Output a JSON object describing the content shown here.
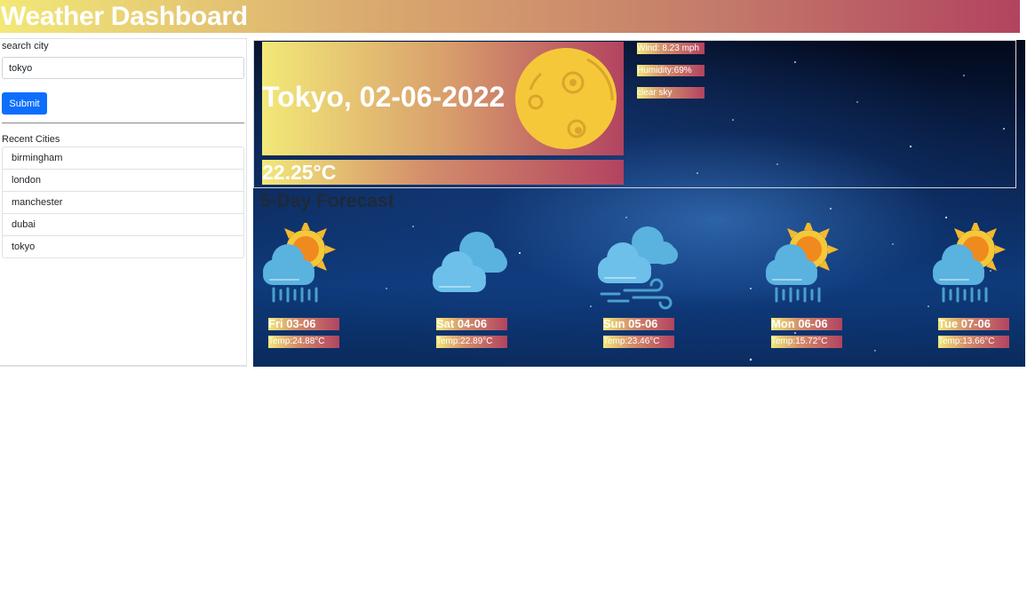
{
  "header": {
    "title": "Weather Dashboard"
  },
  "sidebar": {
    "search_label": "search city",
    "search_value": "tokyo",
    "submit_label": "Submit",
    "recent_label": "Recent Cities",
    "recent_cities": [
      "birmingham",
      "london",
      "manchester",
      "dubai",
      "tokyo"
    ]
  },
  "current": {
    "title": "Tokyo, 02-06-2022",
    "temperature": "22.25°C",
    "wind": "Wind: 8.23 mph",
    "humidity": "Humidity:69%",
    "description": "clear sky",
    "icon": "full-moon-icon"
  },
  "forecast": {
    "title": "5-Day Forecast",
    "days": [
      {
        "date": "Fri 03-06",
        "temp": "Temp:24.88°C",
        "icon": "sun-cloud-rain-icon"
      },
      {
        "date": "Sat 04-06",
        "temp": "Temp:22.89°C",
        "icon": "cloudy-icon"
      },
      {
        "date": "Sun 05-06",
        "temp": "Temp:23.46°C",
        "icon": "cloudy-wind-icon"
      },
      {
        "date": "Mon 06-06",
        "temp": "Temp:15.72°C",
        "icon": "sun-cloud-rain-icon"
      },
      {
        "date": "Tue 07-06",
        "temp": "Temp:13.66°C",
        "icon": "sun-cloud-rain-icon"
      }
    ]
  },
  "colors": {
    "accent_yellow": "#f2e878",
    "accent_pink": "#b24360",
    "submit_blue": "#0d6efd"
  }
}
